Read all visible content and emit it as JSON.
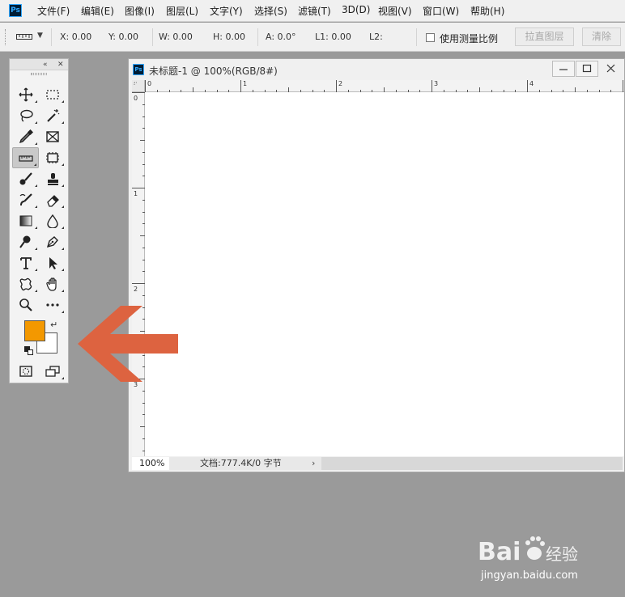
{
  "app": {
    "logo_text": "Ps",
    "menu": [
      "文件(F)",
      "编辑(E)",
      "图像(I)",
      "图层(L)",
      "文字(Y)",
      "选择(S)",
      "滤镜(T)",
      "3D(D)",
      "视图(V)",
      "窗口(W)",
      "帮助(H)"
    ]
  },
  "options_bar": {
    "tool_icon": "ruler-icon",
    "x": "X: 0.00",
    "y": "Y: 0.00",
    "w": "W:  0.00",
    "h": "H:  0.00",
    "a": "A:  0.0°",
    "l1": "L1: 0.00",
    "l2": "L2:",
    "use_measure_scale": "使用测量比例",
    "use_measure_scale_checked": false,
    "straighten_layer": "拉直图层",
    "clear": "清除"
  },
  "toolbox": {
    "tools": [
      [
        "move-tool",
        "marquee-tool"
      ],
      [
        "lasso-tool",
        "magic-wand-tool"
      ],
      [
        "eyedropper-tool",
        "frame-tool"
      ],
      [
        "ruler-tool",
        "crop-tool"
      ],
      [
        "healing-brush-tool",
        "clone-stamp-tool"
      ],
      [
        "history-brush-tool",
        "eraser-tool"
      ],
      [
        "gradient-tool",
        "blur-tool"
      ],
      [
        "dodge-tool",
        "pen-tool"
      ],
      [
        "type-tool",
        "path-selection-tool"
      ],
      [
        "custom-shape-tool",
        "hand-tool"
      ],
      [
        "zoom-tool",
        "more-tools"
      ]
    ],
    "selected_tool": "ruler-tool",
    "foreground_color": "#f39800",
    "background_color": "#ffffff",
    "bottom_tools": [
      "quick-mask-icon",
      "screen-mode-icon"
    ]
  },
  "document": {
    "title": "未标题-1 @ 100%(RGB/8#)",
    "logo_text": "Ps",
    "ruler_h_labels": [
      "0",
      "1",
      "2",
      "3",
      "4"
    ],
    "ruler_v_labels": [
      "0",
      "1",
      "2",
      "3"
    ],
    "zoom": "100%",
    "doc_info": "文档:777.4K/0 字节",
    "status_more": "›"
  },
  "annotation": {
    "arrow_color": "#dd6340",
    "arrow_direction": "left"
  },
  "watermark": {
    "logo": "Bai du 经验",
    "url": "jingyan.baidu.com"
  }
}
